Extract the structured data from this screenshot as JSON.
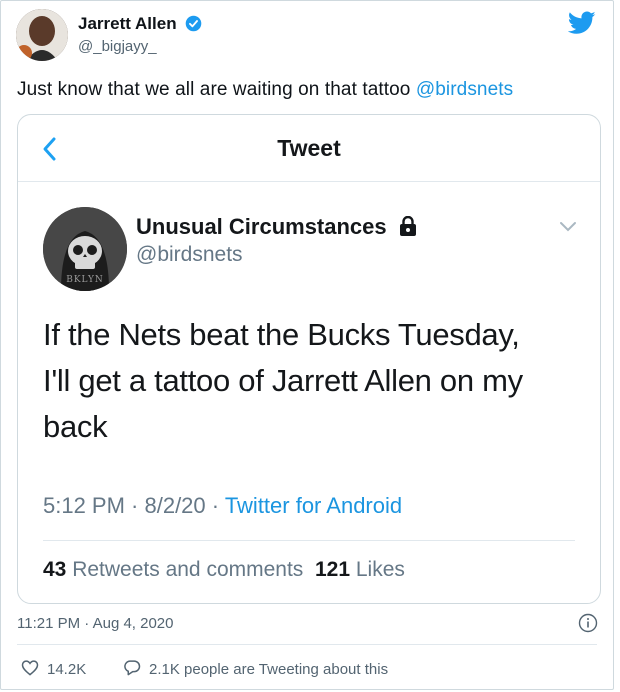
{
  "tweet": {
    "author_name": "Jarrett Allen",
    "author_handle": "@_bigjayy_",
    "text": "Just know that we all are waiting on that tattoo ",
    "mention": "@birdsnets",
    "timestamp": "11:21 PM · Aug 4, 2020",
    "like_count": "14.2K",
    "tweeting_text": "2.1K people are Tweeting about this"
  },
  "screenshot": {
    "header_title": "Tweet",
    "author_name": "Unusual Circumstances",
    "author_handle": "@birdsnets",
    "avatar_caption": "BKLYN",
    "text": "If the Nets beat the Bucks Tuesday,\nI'll get a tattoo of Jarrett Allen on my\nback",
    "time": "5:12 PM · 8/2/20 · ",
    "source": "Twitter for Android",
    "retweets_count": "43",
    "retweets_label": " Retweets and comments  ",
    "likes_count": "121",
    "likes_label": " Likes"
  },
  "colors": {
    "link": "#1b95e0",
    "verified": "#1d9bf0",
    "secondary_text": "#536471"
  },
  "icons": [
    "verified-badge-icon",
    "twitter-logo-icon",
    "back-chevron-icon",
    "lock-icon",
    "chevron-down-icon",
    "info-icon",
    "heart-icon",
    "reply-bubble-icon"
  ]
}
